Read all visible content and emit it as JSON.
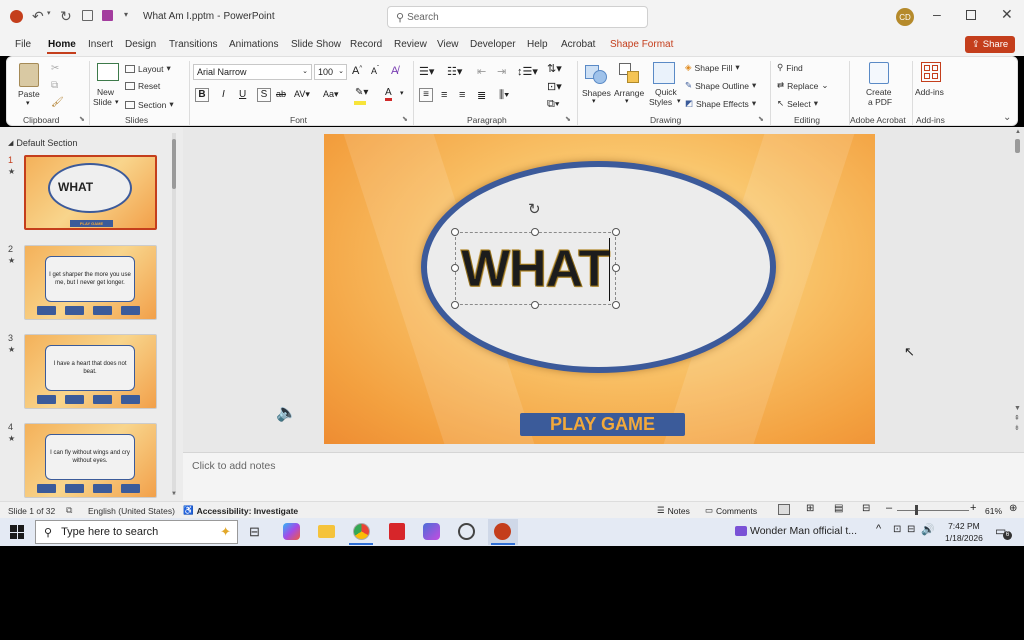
{
  "titlebar": {
    "doc_title": "What Am I.pptm",
    "separator": "-",
    "app_name": "PowerPoint",
    "search_placeholder": "Search",
    "user_initials": "CD"
  },
  "menu": {
    "tabs": [
      "File",
      "Home",
      "Insert",
      "Design",
      "Transitions",
      "Animations",
      "Slide Show",
      "Record",
      "Review",
      "View",
      "Developer",
      "Help",
      "Acrobat",
      "Shape Format"
    ],
    "share_label": "Share"
  },
  "ribbon": {
    "clipboard": {
      "paste": "Paste",
      "label": "Clipboard"
    },
    "slides": {
      "new_slide_line1": "New",
      "new_slide_line2": "Slide",
      "layout": "Layout",
      "reset": "Reset",
      "section": "Section",
      "label": "Slides"
    },
    "font": {
      "font_name": "Arial Narrow",
      "font_size": "100",
      "label": "Font"
    },
    "paragraph": {
      "label": "Paragraph"
    },
    "drawing": {
      "shapes": "Shapes",
      "arrange": "Arrange",
      "quick_styles_line1": "Quick",
      "quick_styles_line2": "Styles",
      "shape_fill": "Shape Fill",
      "shape_outline": "Shape Outline",
      "shape_effects": "Shape Effects",
      "label": "Drawing"
    },
    "editing": {
      "find": "Find",
      "replace": "Replace",
      "select": "Select",
      "label": "Editing"
    },
    "acrobat": {
      "create_line1": "Create",
      "create_line2": "a PDF",
      "label": "Adobe Acrobat"
    },
    "addins": {
      "addins": "Add-ins",
      "label": "Add-ins"
    }
  },
  "slide_panel": {
    "section_name": "Default Section",
    "slides": [
      {
        "number": "1",
        "star": "★",
        "text": "WHAT",
        "button": "PLAY GAME"
      },
      {
        "number": "2",
        "star": "★",
        "text": "I get sharper the more you use me, but I never get longer."
      },
      {
        "number": "3",
        "star": "★",
        "text": "I have a heart that does not beat."
      },
      {
        "number": "4",
        "star": "★",
        "text": "I can fly without wings and cry without eyes."
      }
    ]
  },
  "slide": {
    "title_text": "WHAT",
    "play_button": "PLAY GAME"
  },
  "notes": {
    "placeholder": "Click to add notes"
  },
  "status": {
    "slide_info": "Slide 1 of 32",
    "language": "English (United States)",
    "accessibility": "Accessibility: Investigate",
    "notes_btn": "Notes",
    "comments_btn": "Comments",
    "zoom": "61%"
  },
  "taskbar": {
    "search_placeholder": "Type here to search",
    "media_title": "Wonder Man official t...",
    "time": "7:42 PM",
    "date": "1/18/2026",
    "notification_count": "6"
  },
  "colors": {
    "accent": "#c43e1c",
    "ellipse_border": "#3c5a9a",
    "play_button_bg": "#3b5b9a",
    "play_button_text": "#f2a93b"
  }
}
